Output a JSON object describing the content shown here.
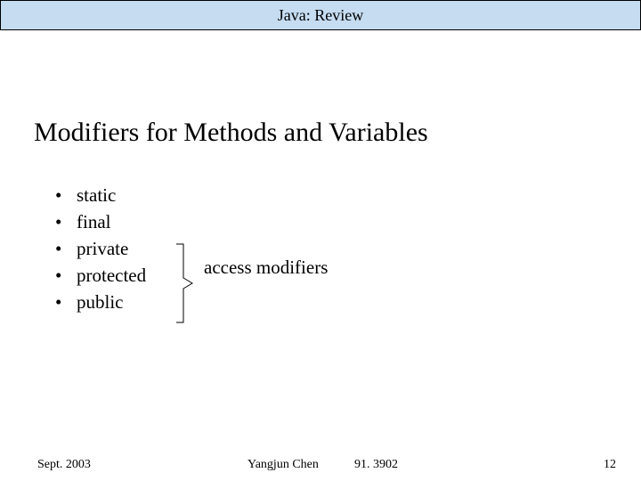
{
  "header": {
    "title": "Java: Review"
  },
  "slide": {
    "title": "Modifiers for Methods and Variables",
    "bullets": [
      "static",
      "final",
      "private",
      "protected",
      "public"
    ],
    "annotation": "access modifiers"
  },
  "footer": {
    "date": "Sept. 2003",
    "author": "Yangjun Chen",
    "course": "91. 3902",
    "page": "12"
  }
}
